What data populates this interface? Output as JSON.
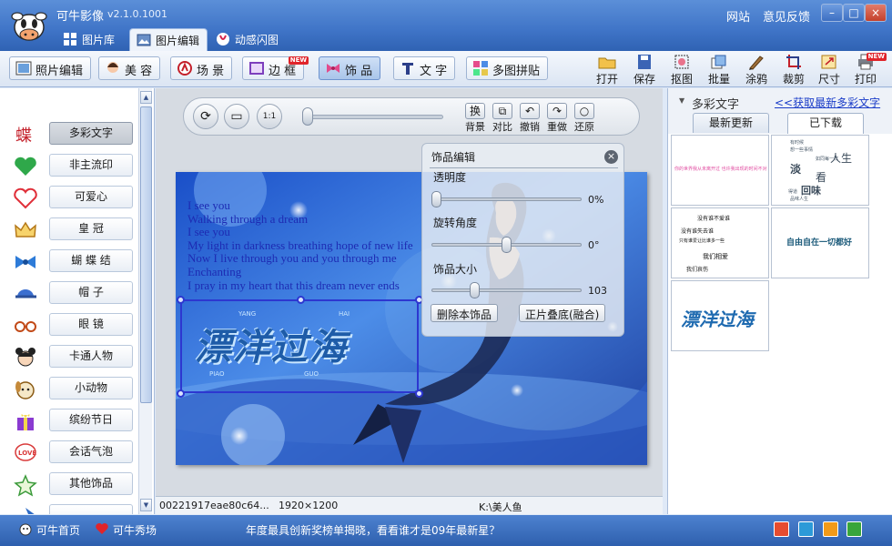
{
  "app": {
    "title": "可牛影像",
    "version": "v2.1.0.1001",
    "links": [
      "网站",
      "意见反馈"
    ],
    "window_controls": [
      "–",
      "□",
      "×"
    ]
  },
  "main_tabs": [
    {
      "label": "图片库",
      "icon": "gallery-icon",
      "active": false
    },
    {
      "label": "图片编辑",
      "icon": "image-edit-icon",
      "active": true
    },
    {
      "label": "动感闪图",
      "icon": "flash-icon",
      "active": false
    }
  ],
  "toolbar": {
    "tools": [
      {
        "label": "照片编辑",
        "icon": "photo-edit-icon",
        "active": false,
        "badge": ""
      },
      {
        "label": "美 容",
        "icon": "beauty-icon",
        "active": false,
        "badge": ""
      },
      {
        "label": "场 景",
        "icon": "scene-icon",
        "active": false,
        "badge": ""
      },
      {
        "label": "边 框",
        "icon": "frame-icon",
        "active": false,
        "badge": "NEW"
      },
      {
        "label": "饰 品",
        "icon": "bow-icon",
        "active": true,
        "badge": ""
      },
      {
        "label": "文 字",
        "icon": "text-icon",
        "active": false,
        "badge": ""
      },
      {
        "label": "多图拼贴",
        "icon": "collage-icon",
        "active": false,
        "badge": ""
      }
    ],
    "actions": [
      {
        "label": "打开",
        "icon": "open-folder-icon",
        "badge": ""
      },
      {
        "label": "保存",
        "icon": "save-disk-icon",
        "badge": ""
      },
      {
        "label": "抠图",
        "icon": "cutout-icon",
        "badge": ""
      },
      {
        "label": "批量",
        "icon": "batch-icon",
        "badge": ""
      },
      {
        "label": "涂鸦",
        "icon": "brush-icon",
        "badge": ""
      },
      {
        "label": "裁剪",
        "icon": "crop-icon",
        "badge": ""
      },
      {
        "label": "尺寸",
        "icon": "resize-icon",
        "badge": ""
      },
      {
        "label": "打印",
        "icon": "printer-icon",
        "badge": "NEW"
      }
    ]
  },
  "categories": [
    {
      "label": "多彩文字",
      "icon": "butterfly-text-icon",
      "active": true
    },
    {
      "label": "非主流印",
      "icon": "heart-stamp-icon",
      "active": false
    },
    {
      "label": "可爱心",
      "icon": "heart-outline-icon",
      "active": false
    },
    {
      "label": "皇 冠",
      "icon": "crown-icon",
      "active": false
    },
    {
      "label": "蝴 蝶 结",
      "icon": "bowtie-icon",
      "active": false
    },
    {
      "label": "帽 子",
      "icon": "cap-icon",
      "active": false
    },
    {
      "label": "眼 镜",
      "icon": "glasses-icon",
      "active": false
    },
    {
      "label": "卡通人物",
      "icon": "cartoon-girl-icon",
      "active": false
    },
    {
      "label": "小动物",
      "icon": "dog-icon",
      "active": false
    },
    {
      "label": "缤纷节日",
      "icon": "gift-icon",
      "active": false
    },
    {
      "label": "会话气泡",
      "icon": "love-bubble-icon",
      "active": false
    },
    {
      "label": "其他饰品",
      "icon": "star-icon",
      "active": false
    }
  ],
  "control_bar": {
    "buttons": [
      "背景",
      "对比",
      "撤销",
      "重做",
      "还原"
    ],
    "icons": [
      "换",
      "⧉",
      "↶",
      "↷",
      "○"
    ],
    "zoom_label": "1:1"
  },
  "canvas": {
    "lyrics": "I see you\nWalking through a dream\nI see you\nMy light in darkness breathing hope of new life\nNow I live through you and you through me\nEnchanting\nI pray in my heart that this dream never ends",
    "decoration_text": "漂洋过海",
    "decoration_small": [
      "YANG",
      "HAI",
      "PIAO",
      "GUO"
    ]
  },
  "info_bar": {
    "filename": "00221917eae80c64...",
    "dimensions": "1920×1200",
    "path": "K:\\美人鱼"
  },
  "ornament_panel": {
    "title": "饰品编辑",
    "opacity_label": "透明度",
    "opacity_value": "0%",
    "opacity_level": 0.0,
    "rotation_label": "旋转角度",
    "rotation_value": "0°",
    "rotation_level": 0.5,
    "size_label": "饰品大小",
    "size_value": "103",
    "size_level": 0.27,
    "delete_label": "删除本饰品",
    "blend_label": "正片叠底(融合)"
  },
  "right_panel": {
    "title": "多彩文字",
    "link": "<<获取最新多彩文字",
    "tabs": [
      {
        "label": "最新更新",
        "active": false
      },
      {
        "label": "已下载",
        "active": true
      }
    ],
    "thumbs": [
      {
        "lines": [
          "你的世界我从未离开过 也许我出现的时间不对"
        ]
      },
      {
        "lines": [
          "有时候",
          "想一些事情",
          "如同每一样",
          "淡",
          "人生",
          "看",
          "回味",
          "得道",
          "品味人生"
        ]
      },
      {
        "lines": [
          "没有谁不爱谁",
          "没有谁失去谁",
          "只有谁爱让比谁多一些",
          "我们相爱",
          "我们哀伤"
        ]
      },
      {
        "lines": [
          "自由自在一切都好"
        ]
      },
      {
        "lines": [
          "漂洋过海"
        ]
      }
    ]
  },
  "bottom_bar": {
    "home": "可牛首页",
    "show": "可牛秀场",
    "news": "年度最具创新奖榜单揭晓，看看谁才是09年最新星？",
    "square_colors": [
      "#e64c2f",
      "#2c9ad8",
      "#f29a19",
      "#38a53b"
    ]
  }
}
